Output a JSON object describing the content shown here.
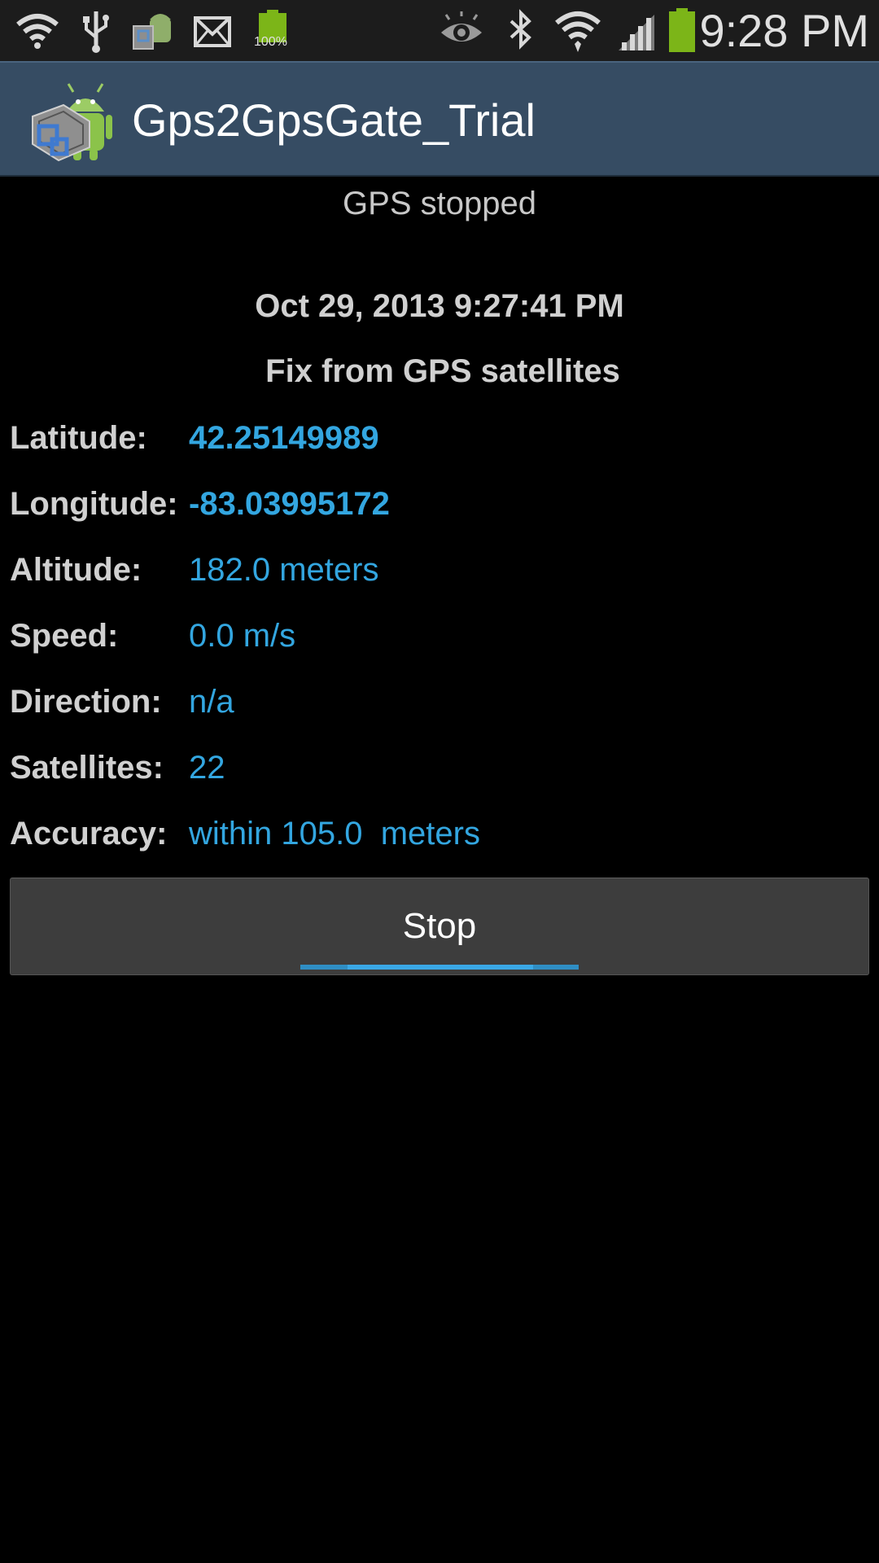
{
  "status_bar": {
    "clock": "9:28 PM",
    "notification_battery_label": "100%",
    "icons": [
      "wifi-question-icon",
      "usb-icon",
      "gps-app-notification-icon",
      "email-icon",
      "battery-notification-icon",
      "eye-icon",
      "bluetooth-icon",
      "wifi-icon",
      "signal-icon",
      "battery-icon"
    ],
    "battery_level": 1.0
  },
  "app_bar": {
    "title": "Gps2GpsGate_Trial"
  },
  "main": {
    "gps_status": "GPS stopped",
    "fix_time": "Oct 29, 2013 9:27:41 PM",
    "fix_source": "Fix from GPS satellites",
    "fields": [
      {
        "label": "Latitude:",
        "value": "42.25149989"
      },
      {
        "label": "Longitude:",
        "value": "-83.03995172"
      },
      {
        "label": "Altitude:",
        "value": "182.0 meters"
      },
      {
        "label": "Speed:",
        "value": "0.0 m/s"
      },
      {
        "label": "Direction:",
        "value": "n/a"
      },
      {
        "label": "Satellites:",
        "value": "22"
      },
      {
        "label": "Accuracy:",
        "value": "within 105.0  meters"
      }
    ],
    "stop_button_label": "Stop"
  },
  "colors": {
    "accent": "#33a6e0",
    "app_bar": "#364c63",
    "battery_green": "#7cb518"
  }
}
